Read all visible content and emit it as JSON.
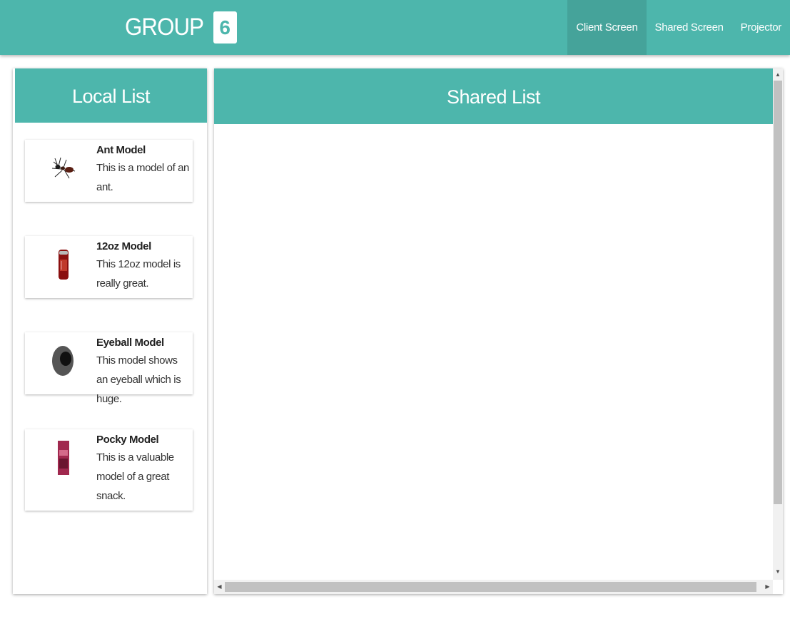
{
  "header": {
    "logo_text": "GROUP",
    "logo_badge": "6",
    "nav": [
      {
        "label": "Client Screen",
        "active": true
      },
      {
        "label": "Shared Screen",
        "active": false
      },
      {
        "label": "Projector",
        "active": false
      }
    ]
  },
  "local_list": {
    "title": "Local List",
    "items": [
      {
        "title": "Ant Model",
        "description": "This is a model of an ant.",
        "icon": "ant-icon"
      },
      {
        "title": "12oz Model",
        "description": "This 12oz model is really great.",
        "icon": "soda-can-icon"
      },
      {
        "title": "Eyeball Model",
        "description": "This model shows an eyeball which is huge.",
        "icon": "eyeball-icon"
      },
      {
        "title": "Pocky Model",
        "description": "This is a valuable model of a great snack.",
        "icon": "pocky-box-icon"
      }
    ]
  },
  "shared_list": {
    "title": "Shared List",
    "items": []
  },
  "colors": {
    "accent": "#4db6ac",
    "text": "#222222"
  }
}
